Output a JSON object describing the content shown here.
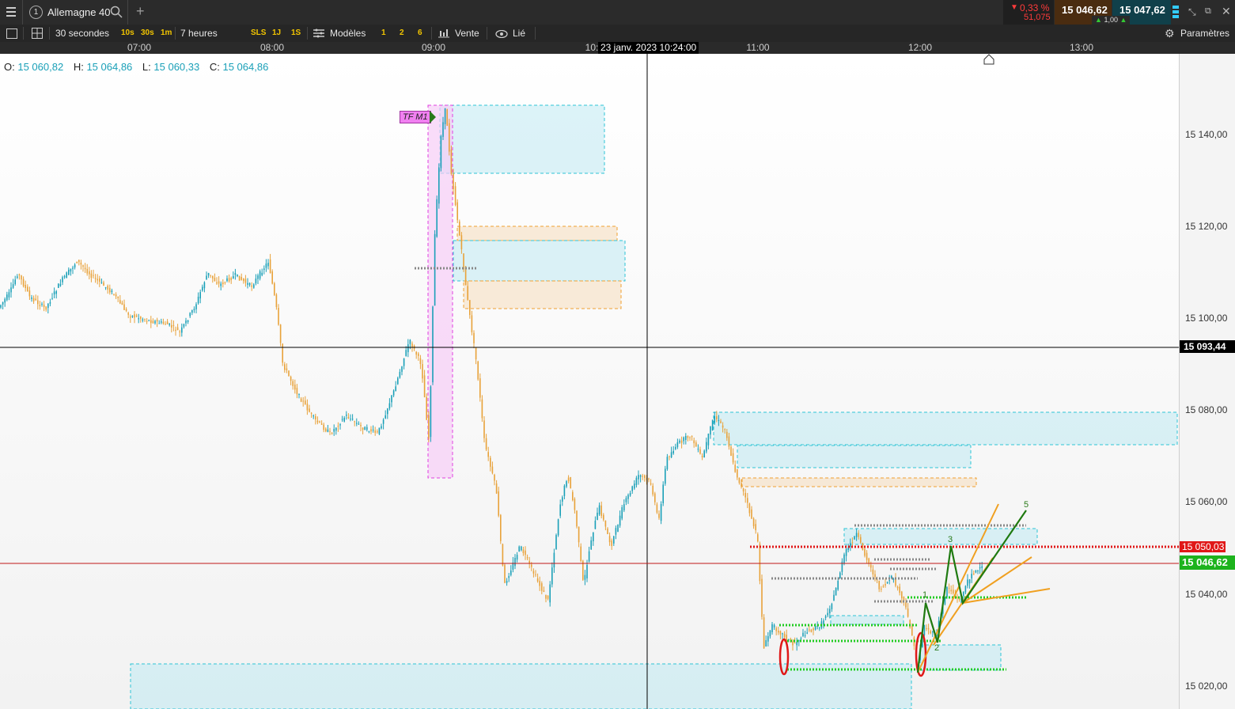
{
  "window": {
    "tab_number": "1",
    "instrument": "Allemagne 40",
    "change_percent": "0,33 %",
    "change_value": "51,075",
    "bid": "15 046,62",
    "ask": "15 047,62",
    "spread": "1,00"
  },
  "toolbar": {
    "interval": "30 secondes",
    "quick_intervals": [
      "10s",
      "30s",
      "1m"
    ],
    "range": "7 heures",
    "quick_ranges": [
      "SLS",
      "1J",
      "1S"
    ],
    "templates_label": "Modèles",
    "template_slots": [
      "1",
      "2",
      "6"
    ],
    "sell_label": "Vente",
    "linked_label": "Lié",
    "settings_label": "Paramètres"
  },
  "time_axis": {
    "ticks": [
      "07:00",
      "08:00",
      "09:00",
      "10:",
      "11:00",
      "12:00",
      "13:00"
    ],
    "crosshair_label": "23 janv. 2023 10:24:00"
  },
  "ohlc": {
    "o_label": "O:",
    "o_value": "15 060,82",
    "h_label": "H:",
    "h_value": "15 064,86",
    "l_label": "L:",
    "l_value": "15 060,33",
    "c_label": "C:",
    "c_value": "15 064,86"
  },
  "price_axis": {
    "ticks": [
      "15 140,00",
      "15 120,00",
      "15 100,00",
      "15 080,00",
      "15 060,00",
      "15 040,00",
      "15 020,00"
    ],
    "crosshair_price": "15 093,44",
    "alert_price": "15 050,03",
    "last_price": "15 046,62"
  },
  "annotations": {
    "tf_label": "TF M1",
    "wave_labels": [
      "1",
      "2",
      "3",
      "5"
    ]
  },
  "colors": {
    "up": "#1aa0b8",
    "down": "#e8a23a",
    "alert": "#e01818",
    "last": "#1db31d",
    "zone_blue": "#bfe9f2",
    "zone_orange": "#f6dcbc",
    "magenta": "#e040e0",
    "negative": "#ff3b3b"
  }
}
